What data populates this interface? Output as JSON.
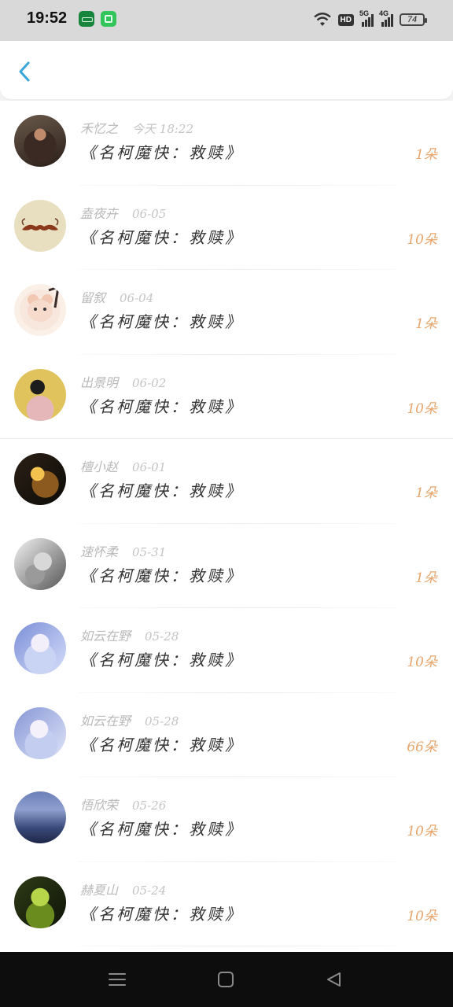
{
  "status_bar": {
    "time": "19:52",
    "hd_label": "HD",
    "signal1_label": "5G",
    "signal2_label": "4G",
    "battery": "74"
  },
  "header": {
    "back_icon": "chevron-left-icon",
    "accent_color": "#3aa6d9"
  },
  "items": [
    {
      "user": "禾忆之",
      "date": "今天 18:22",
      "title": "《名柯魔快：救赎》",
      "count": "1朵"
    },
    {
      "user": "盍夜卉",
      "date": "06-05",
      "title": "《名柯魔快：救赎》",
      "count": "10朵"
    },
    {
      "user": "留叙",
      "date": "06-04",
      "title": "《名柯魔快：救赎》",
      "count": "1朵"
    },
    {
      "user": "出景明",
      "date": "06-02",
      "title": "《名柯魔快：救赎》",
      "count": "10朵"
    },
    {
      "user": "檀小赵",
      "date": "06-01",
      "title": "《名柯魔快：救赎》",
      "count": "1朵"
    },
    {
      "user": "速怀柔",
      "date": "05-31",
      "title": "《名柯魔快：救赎》",
      "count": "1朵"
    },
    {
      "user": "如云在野",
      "date": "05-28",
      "title": "《名柯魔快：救赎》",
      "count": "10朵"
    },
    {
      "user": "如云在野",
      "date": "05-28",
      "title": "《名柯魔快：救赎》",
      "count": "66朵"
    },
    {
      "user": "悟欣荣",
      "date": "05-26",
      "title": "《名柯魔快：救赎》",
      "count": "10朵"
    },
    {
      "user": "赫夏山",
      "date": "05-24",
      "title": "《名柯魔快：救赎》",
      "count": "10朵"
    }
  ],
  "count_color": "#e8a56c",
  "nav_bar": {
    "menu_icon": "menu-icon",
    "home_icon": "square-home-icon",
    "back_icon": "triangle-back-icon"
  }
}
